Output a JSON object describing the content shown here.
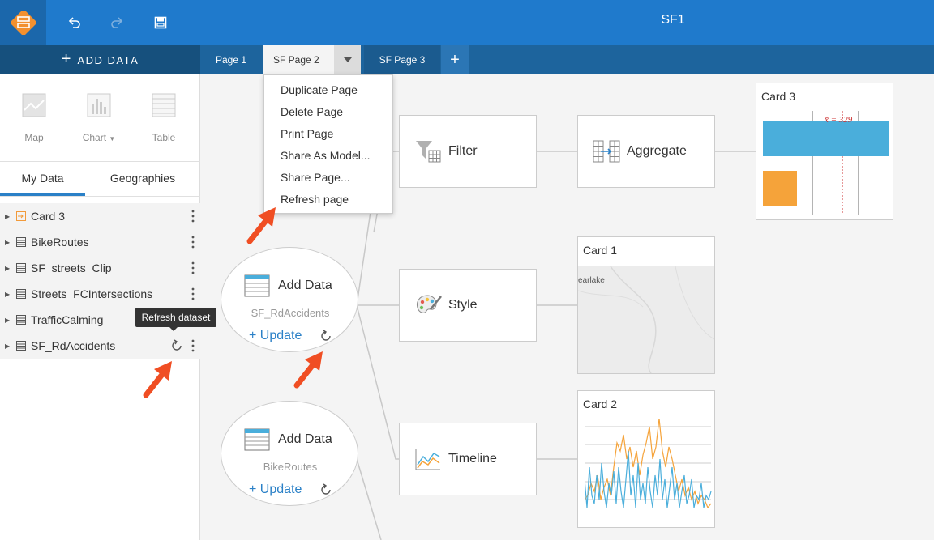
{
  "app": {
    "title": "SF1"
  },
  "header": {
    "add_data_label": "ADD DATA",
    "tabs": [
      {
        "label": "Page 1"
      },
      {
        "label": "SF Page 2"
      },
      {
        "label": "SF Page 3"
      }
    ]
  },
  "viz_buttons": [
    {
      "label": "Map",
      "icon": "map-icon"
    },
    {
      "label": "Chart",
      "icon": "chart-icon"
    },
    {
      "label": "Table",
      "icon": "table-icon"
    }
  ],
  "data_tabs": {
    "my_data": "My Data",
    "geographies": "Geographies"
  },
  "datasets": [
    {
      "name": "Card 3",
      "icon": "card-icon"
    },
    {
      "name": "BikeRoutes",
      "icon": "table-icon"
    },
    {
      "name": "SF_streets_Clip",
      "icon": "table-icon"
    },
    {
      "name": "Streets_FCIntersections",
      "icon": "table-icon"
    },
    {
      "name": "TrafficCalming",
      "icon": "table-icon"
    },
    {
      "name": "SF_RdAccidents",
      "icon": "table-icon"
    }
  ],
  "tooltip": "Refresh dataset",
  "page_menu": [
    "Duplicate Page",
    "Delete Page",
    "Print Page",
    "Share As Model...",
    "Share Page...",
    "Refresh page"
  ],
  "nodes": {
    "filter": "Filter",
    "aggregate": "Aggregate",
    "style": "Style",
    "timeline": "Timeline"
  },
  "sources": [
    {
      "title": "Add Data",
      "subtitle": "SF_RdAccidents",
      "update": "Update"
    },
    {
      "title": "Add Data",
      "subtitle": "BikeRoutes",
      "update": "Update"
    }
  ],
  "cards": {
    "card3": {
      "title": "Card 3",
      "annotation": "x̄ = 329"
    },
    "card1": {
      "title": "Card 1",
      "map_label": "earlake"
    },
    "card2": {
      "title": "Card 2"
    }
  },
  "colors": {
    "primary": "#1f7acc",
    "tabbar": "#16507d",
    "accent_orange": "#f5a33a",
    "accent_blue": "#4aaedb",
    "arrow": "#f04e23"
  }
}
